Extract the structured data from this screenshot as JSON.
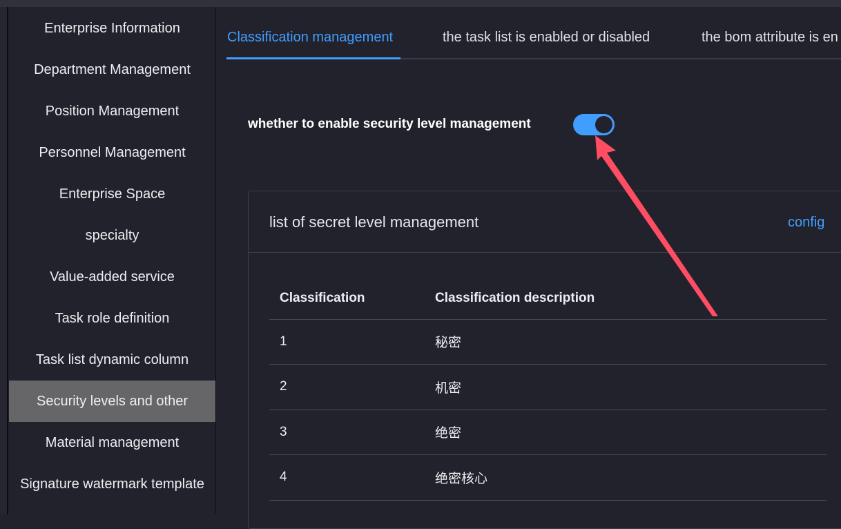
{
  "sidebar": {
    "items": [
      "Enterprise Information",
      "Department Management",
      "Position Management",
      "Personnel Management",
      "Enterprise Space",
      "specialty",
      "Value-added service",
      "Task role definition",
      "Task list dynamic column",
      "Security levels and other",
      "Material management",
      "Signature watermark template"
    ],
    "active": "Security levels and other"
  },
  "tabs": [
    "Classification management",
    "the task list is enabled or disabled",
    "the bom attribute is en"
  ],
  "toggle": {
    "label": "whether to enable security level management",
    "enabled": true
  },
  "card": {
    "title": "list of secret level management",
    "config_label": "config",
    "columns": [
      "Classification",
      "Classification description"
    ],
    "rows": [
      [
        "1",
        "秘密"
      ],
      [
        "2",
        "机密"
      ],
      [
        "3",
        "绝密"
      ],
      [
        "4",
        "绝密核心"
      ]
    ]
  },
  "colors": {
    "accent": "#409eff",
    "annotation_arrow": "#ff4d63"
  }
}
